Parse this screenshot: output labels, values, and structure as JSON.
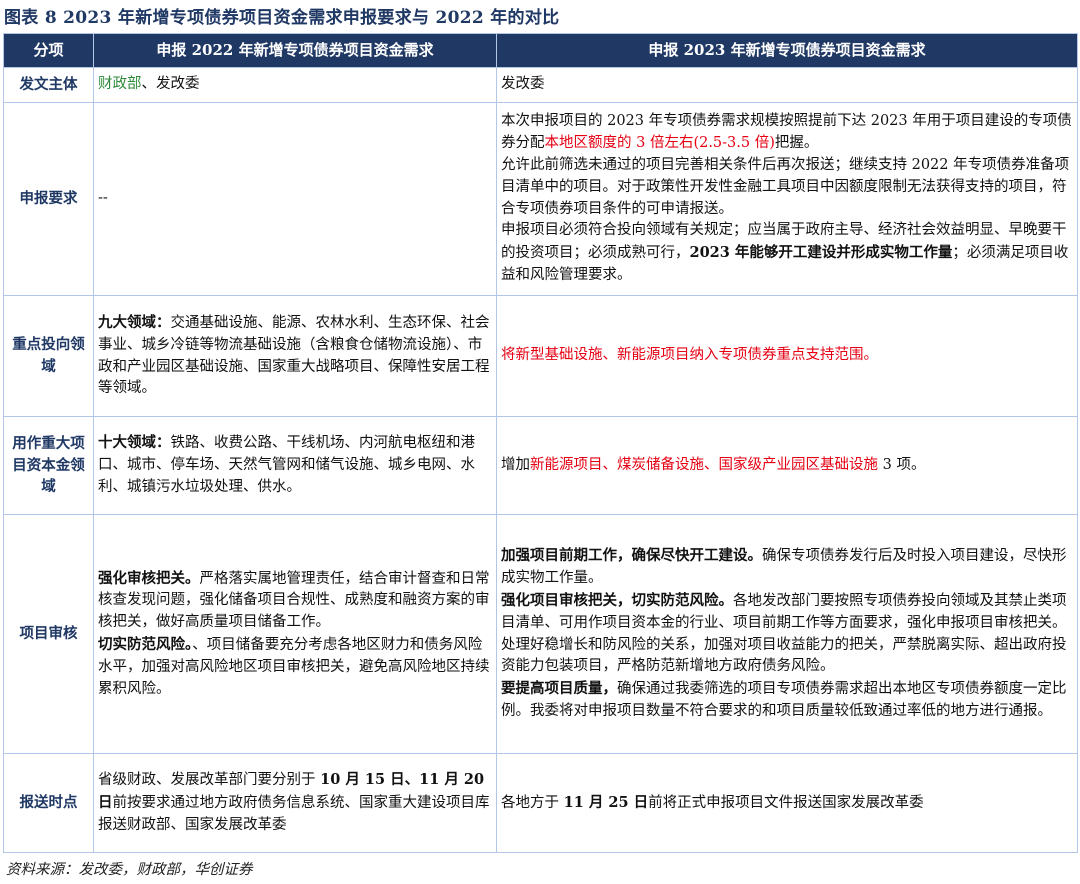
{
  "title": "图表 8  2023 年新增专项债券项目资金需求申报要求与 2022 年的对比",
  "header": {
    "col1": "分项",
    "col2": "申报 2022 年新增专项债券项目资金需求",
    "col3": "申报 2023 年新增专项债券项目资金需求"
  },
  "rows": {
    "issuer": {
      "label": "发文主体",
      "c2_green": "财政部",
      "c2_rest": "、发改委",
      "c3": "发改委"
    },
    "requirements": {
      "label": "申报要求",
      "c2": "--",
      "p1_a": "本次申报项目的 2023 年专项债券需求规模按照提前下达 2023 年用于项目建设的专项债券分配",
      "p1_red": "本地区额度的 3 倍左右(2.5-3.5 倍)",
      "p1_b": "把握。",
      "p2": "允许此前筛选未通过的项目完善相关条件后再次报送；继续支持 2022 年专项债券准备项目清单中的项目。对于政策性开发性金融工具项目中因额度限制无法获得支持的项目，符合专项债券项目条件的可申请报送。",
      "p3_a": "申报项目必须符合投向领域有关规定；应当属于政府主导、经济社会效益明显、早晚要干的投资项目；必须成熟可行，",
      "p3_bold": "2023 年能够开工建设并形成实物工作量",
      "p3_b": "；必须满足项目收益和风险管理要求。"
    },
    "focus": {
      "label": "重点投向领域",
      "c2_bold": "九大领域：",
      "c2_text": "交通基础设施、能源、农林水利、生态环保、社会事业、城乡冷链等物流基础设施（含粮食仓储物流设施）、市政和产业园区基础设施、国家重大战略项目、保障性安居工程等领域。",
      "c3_red": "将新型基础设施、新能源项目纳入专项债券重点支持范围。"
    },
    "capital": {
      "label": "用作重大项目资本金领域",
      "c2_bold": "十大领域：",
      "c2_text": "铁路、收费公路、干线机场、内河航电枢纽和港口、城市、停车场、天然气管网和储气设施、城乡电网、水利、城镇污水垃圾处理、供水。",
      "c3_a": "增加",
      "c3_red": "新能源项目、煤炭储备设施、国家级产业园区基础设施",
      "c3_b": " 3 项。"
    },
    "review": {
      "label": "项目审核",
      "c2_p1_bold": "强化审核把关。",
      "c2_p1_text": "严格落实属地管理责任，结合审计督查和日常核查发现问题，强化储备项目合规性、成熟度和融资方案的审核把关，做好高质量项目储备工作。",
      "c2_p2_bold": "切实防范风险。",
      "c2_p2_text": "、项目储备要充分考虑各地区财力和债务风险水平，加强对高风险地区项目审核把关，避免高风险地区持续累积风险。",
      "c3_p1_bold": "加强项目前期工作，确保尽快开工建设。",
      "c3_p1_text": "确保专项债券发行后及时投入项目建设，尽快形成实物工作量。",
      "c3_p2_bold": "强化项目审核把关，切实防范风险。",
      "c3_p2_text": "各地发改部门要按照专项债券投向领域及其禁止类项目清单、可用作项目资本金的行业、项目前期工作等方面要求，强化申报项目审核把关。处理好稳增长和防风险的关系，加强对项目收益能力的把关，严禁脱离实际、超出政府投资能力包装项目，严格防范新增地方政府债务风险。",
      "c3_p3_bold": "要提高项目质量，",
      "c3_p3_text": "确保通过我委筛选的项目专项债券需求超出本地区专项债券额度一定比例。我委将对申报项目数量不符合要求的和项目质量较低致通过率低的地方进行通报。"
    },
    "deadline": {
      "label": "报送时点",
      "c2_a": "省级财政、发展改革部门要分别于 ",
      "c2_b1": "10 月 15 日",
      "c2_m": "、",
      "c2_b2": "11 月 20 日",
      "c2_c": "前按要求通过地方政府债务信息系统、国家重大建设项目库报送财政部、国家发展改革委",
      "c3_a": "各地方于 ",
      "c3_bold": "11 月 25 日",
      "c3_b": "前将正式申报项目文件报送国家发展改革委"
    }
  },
  "source": "资料来源：发改委，财政部，华创证券"
}
